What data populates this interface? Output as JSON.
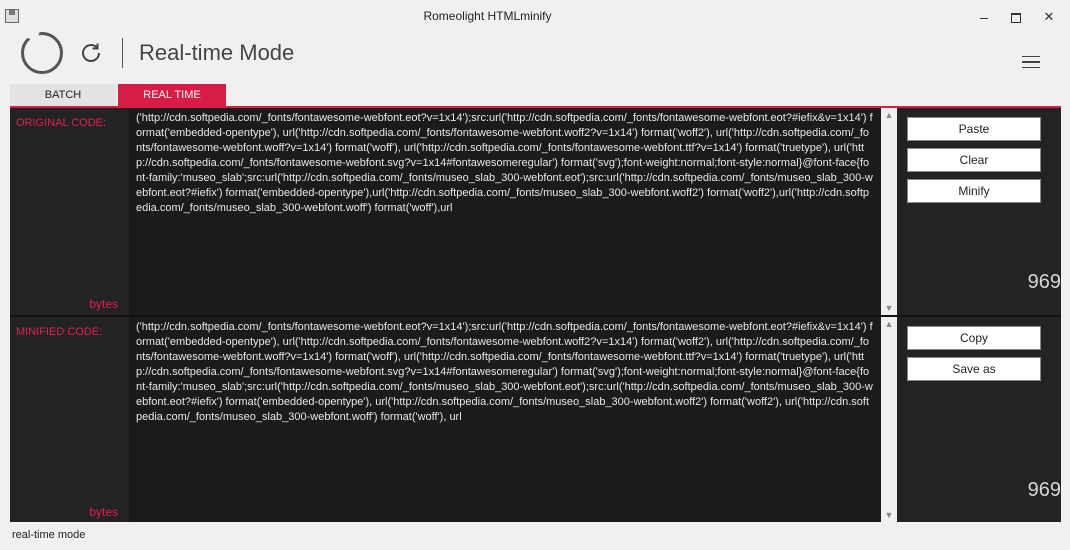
{
  "window": {
    "title": "Romeolight HTMLminify"
  },
  "header": {
    "mode_title": "Real-time Mode"
  },
  "tabs": [
    {
      "label": "BATCH"
    },
    {
      "label": "REAL TIME"
    }
  ],
  "original": {
    "label": "ORIGINAL CODE:",
    "code": "('http://cdn.softpedia.com/_fonts/fontawesome-webfont.eot?v=1x14');src:url('http://cdn.softpedia.com/_fonts/fontawesome-webfont.eot?#iefix&v=1x14') format('embedded-opentype'), url('http://cdn.softpedia.com/_fonts/fontawesome-webfont.woff2?v=1x14') format('woff2'), url('http://cdn.softpedia.com/_fonts/fontawesome-webfont.woff?v=1x14') format('woff'), url('http://cdn.softpedia.com/_fonts/fontawesome-webfont.ttf?v=1x14') format('truetype'), url('http://cdn.softpedia.com/_fonts/fontawesome-webfont.svg?v=1x14#fontawesomeregular') format('svg');font-weight:normal;font-style:normal}@font-face{font-family:'museo_slab';src:url('http://cdn.softpedia.com/_fonts/museo_slab_300-webfont.eot');src:url('http://cdn.softpedia.com/_fonts/museo_slab_300-webfont.eot?#iefix') format('embedded-opentype'),url('http://cdn.softpedia.com/_fonts/museo_slab_300-webfont.woff2') format('woff2'),url('http://cdn.softpedia.com/_fonts/museo_slab_300-webfont.woff') format('woff'),url",
    "size": "969",
    "unit": "bytes"
  },
  "minified": {
    "label": "MINIFIED CODE:",
    "code": "('http://cdn.softpedia.com/_fonts/fontawesome-webfont.eot?v=1x14');src:url('http://cdn.softpedia.com/_fonts/fontawesome-webfont.eot?#iefix&v=1x14') format('embedded-opentype'), url('http://cdn.softpedia.com/_fonts/fontawesome-webfont.woff2?v=1x14') format('woff2'), url('http://cdn.softpedia.com/_fonts/fontawesome-webfont.woff?v=1x14') format('woff'), url('http://cdn.softpedia.com/_fonts/fontawesome-webfont.ttf?v=1x14') format('truetype'), url('http://cdn.softpedia.com/_fonts/fontawesome-webfont.svg?v=1x14#fontawesomeregular') format('svg');font-weight:normal;font-style:normal}@font-face{font-family:'museo_slab';src:url('http://cdn.softpedia.com/_fonts/museo_slab_300-webfont.eot');src:url('http://cdn.softpedia.com/_fonts/museo_slab_300-webfont.eot?#iefix') format('embedded-opentype'), url('http://cdn.softpedia.com/_fonts/museo_slab_300-webfont.woff2') format('woff2'), url('http://cdn.softpedia.com/_fonts/museo_slab_300-webfont.woff') format('woff'), url",
    "size": "969",
    "unit": "bytes"
  },
  "buttons": {
    "paste": "Paste",
    "clear": "Clear",
    "minify": "Minify",
    "copy": "Copy",
    "save_as": "Save as"
  },
  "status": "real-time mode",
  "colors": {
    "accent": "#d81c45",
    "panel_bg": "#232326",
    "code_bg": "#1b1b1e"
  }
}
